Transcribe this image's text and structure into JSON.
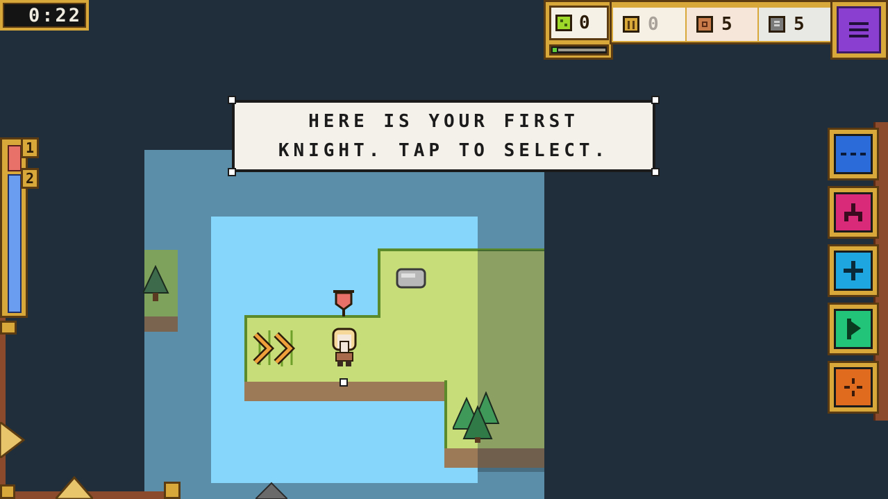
{
  "timer": {
    "value": "0:22"
  },
  "resources": {
    "gems": {
      "icon": "green-gem-icon",
      "value": "0",
      "color": "#9ed92a"
    },
    "gold": {
      "icon": "gold-pillar-icon",
      "value": "0",
      "color": "#d9a83a"
    },
    "wood": {
      "icon": "wood-block-icon",
      "value": "5",
      "color": "#c97b4a"
    },
    "stone": {
      "icon": "stone-block-icon",
      "value": "5",
      "color": "#7a7a7a"
    },
    "progress": 0.08
  },
  "menu": {
    "icon": "hamburger-menu-icon",
    "color": "#8a3fd1"
  },
  "health": {
    "badge_1": "1",
    "badge_2": "2",
    "red_color": "#e8726a",
    "blue_color": "#6a9df0"
  },
  "tutorial": {
    "line1": "HERE IS YOUR FIRST",
    "line2": "KNIGHT. TAP TO SELECT."
  },
  "tools": [
    {
      "icon": "ellipsis-icon",
      "color": "#2a6ad9"
    },
    {
      "icon": "castle-icon",
      "color": "#d92a7a"
    },
    {
      "icon": "plus-icon",
      "color": "#1ea6e0"
    },
    {
      "icon": "play-flag-icon",
      "color": "#22c47a"
    },
    {
      "icon": "crosshair-icon",
      "color": "#e06a1e"
    }
  ]
}
